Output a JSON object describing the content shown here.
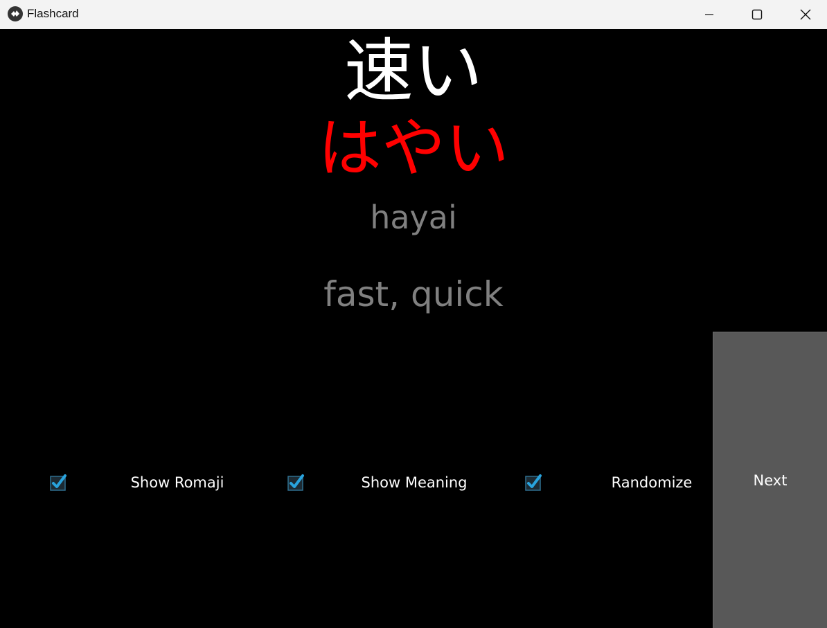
{
  "window": {
    "title": "Flashcard",
    "controls": [
      "minimize",
      "maximize",
      "close"
    ]
  },
  "card": {
    "kanji": "速い",
    "kana": "はやい",
    "romaji": "hayai",
    "meaning": "fast, quick"
  },
  "options": [
    {
      "label": "Show Romaji",
      "checked": true
    },
    {
      "label": "Show Meaning",
      "checked": true
    },
    {
      "label": "Randomize",
      "checked": true
    }
  ],
  "next_button": {
    "label": "Next"
  },
  "colors": {
    "background": "#000000",
    "kanji": "#ffffff",
    "kana": "#ff0000",
    "secondary_text": "#808080",
    "button": "#585858",
    "checkbox_accent": "#29a3dd"
  }
}
